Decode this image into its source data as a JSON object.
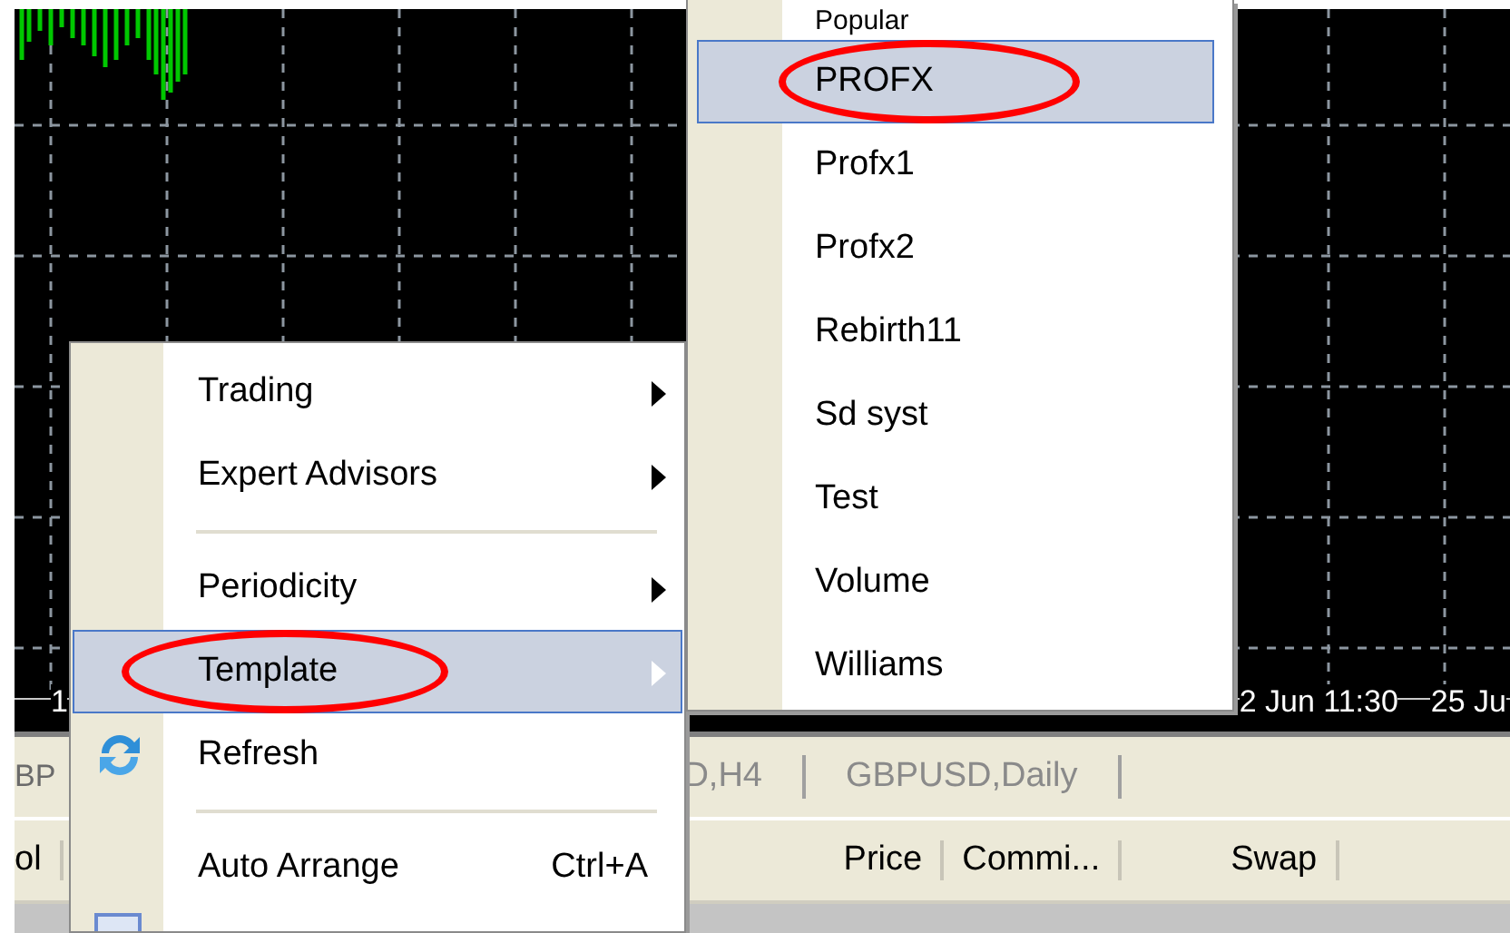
{
  "chart": {
    "axis_labels": [
      {
        "text": "1",
        "kind": "left"
      },
      {
        "text": "2 Jun 11:30",
        "kind": "right"
      },
      {
        "text": "25 Ju",
        "kind": "right"
      }
    ]
  },
  "chart_tabs": [
    {
      "label": "BP",
      "kind": "left"
    },
    {
      "label": "D,H4",
      "kind": "right"
    },
    {
      "label": "GBPUSD,Daily",
      "kind": "right"
    }
  ],
  "table": {
    "columns": [
      {
        "label": "ol",
        "kind": "left"
      },
      {
        "label": "Price",
        "kind": "right"
      },
      {
        "label": "Commi...",
        "kind": "right"
      },
      {
        "label": "Swap",
        "kind": "right"
      }
    ]
  },
  "context_menu": {
    "items": [
      {
        "kind": "item",
        "label": "Trading",
        "submenu": true,
        "selected": false
      },
      {
        "kind": "item",
        "label": "Expert Advisors",
        "submenu": true,
        "selected": false
      },
      {
        "kind": "separator"
      },
      {
        "kind": "item",
        "label": "Periodicity",
        "submenu": true,
        "selected": false
      },
      {
        "kind": "item",
        "label": "Template",
        "submenu": true,
        "selected": true,
        "circled": true
      },
      {
        "kind": "icon_item",
        "label": "Refresh",
        "submenu": false,
        "selected": false
      },
      {
        "kind": "separator"
      },
      {
        "kind": "item",
        "label": "Auto Arrange",
        "shortcut": "Ctrl+A",
        "submenu": false,
        "selected": false
      },
      {
        "kind": "partial"
      }
    ]
  },
  "template_submenu": {
    "items": [
      {
        "label": "Popular",
        "selected": false,
        "kind": "cut"
      },
      {
        "label": "PROFX",
        "selected": true,
        "circled": true
      },
      {
        "label": "Profx1",
        "selected": false
      },
      {
        "label": "Profx2",
        "selected": false
      },
      {
        "label": "Rebirth11",
        "selected": false
      },
      {
        "label": "Sd syst",
        "selected": false
      },
      {
        "label": "Test",
        "selected": false
      },
      {
        "label": "Volume",
        "selected": false
      },
      {
        "label": "Williams",
        "selected": false
      }
    ]
  }
}
